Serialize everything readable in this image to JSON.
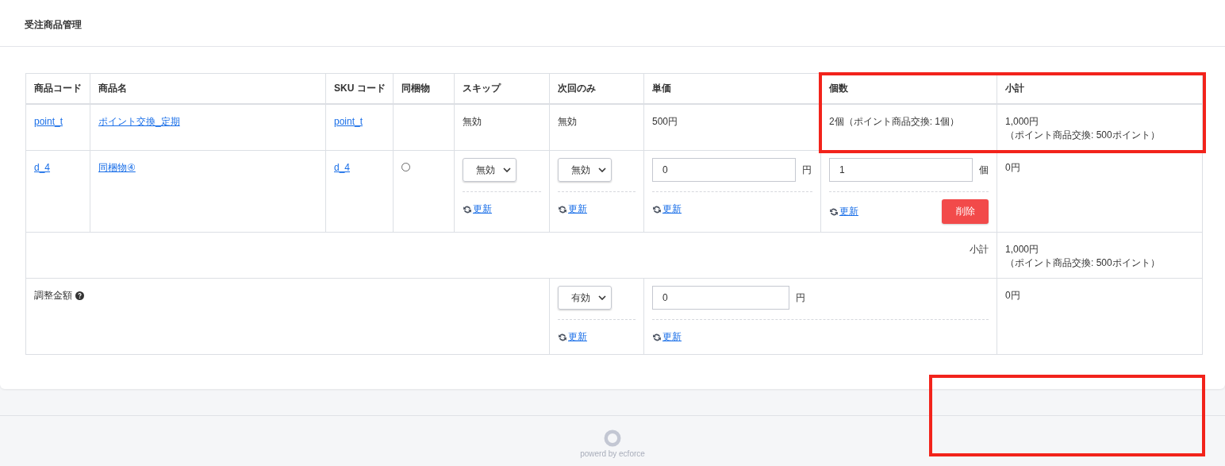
{
  "card": {
    "title": "受注商品管理"
  },
  "table": {
    "columns": [
      "商品コード",
      "商品名",
      "SKU コード",
      "同梱物",
      "スキップ",
      "次回のみ",
      "単価",
      "個数",
      "小計"
    ],
    "rows": [
      {
        "kind": "fixed",
        "code": "point_t",
        "name": "ポイント交換_定期",
        "sku": "point_t",
        "bundled": false,
        "skip": "無効",
        "next_only": "無効",
        "price": "500円",
        "quantity": "2個（ポイント商品交換: 1個）",
        "subtotal": [
          "1,000円",
          "（ポイント商品交換: 500ポイント）"
        ]
      },
      {
        "kind": "editable",
        "code": "d_4",
        "name": "同梱物④",
        "sku": "d_4",
        "bundled": true,
        "skip": "無効",
        "skip_update": "更新",
        "next_only": "無効",
        "next_only_update": "更新",
        "price": "0",
        "price_unit": "円",
        "price_update": "更新",
        "quantity": "1",
        "quantity_unit": "個",
        "quantity_update": "更新",
        "delete": "削除",
        "subtotal": [
          "0円"
        ]
      }
    ],
    "subtotal_row": {
      "label": "小計",
      "value": [
        "1,000円",
        "（ポイント商品交換: 500ポイント）"
      ]
    },
    "adjustment_row": {
      "label": "調整金額",
      "select": "有効",
      "select_update": "更新",
      "amount": "0",
      "amount_unit": "円",
      "amount_update": "更新",
      "subtotal": "0円"
    }
  },
  "footer": {
    "text": "powerd by ecforce"
  },
  "highlight_frames": {
    "quantity_subtotal_cells": true,
    "footer_area": true
  }
}
